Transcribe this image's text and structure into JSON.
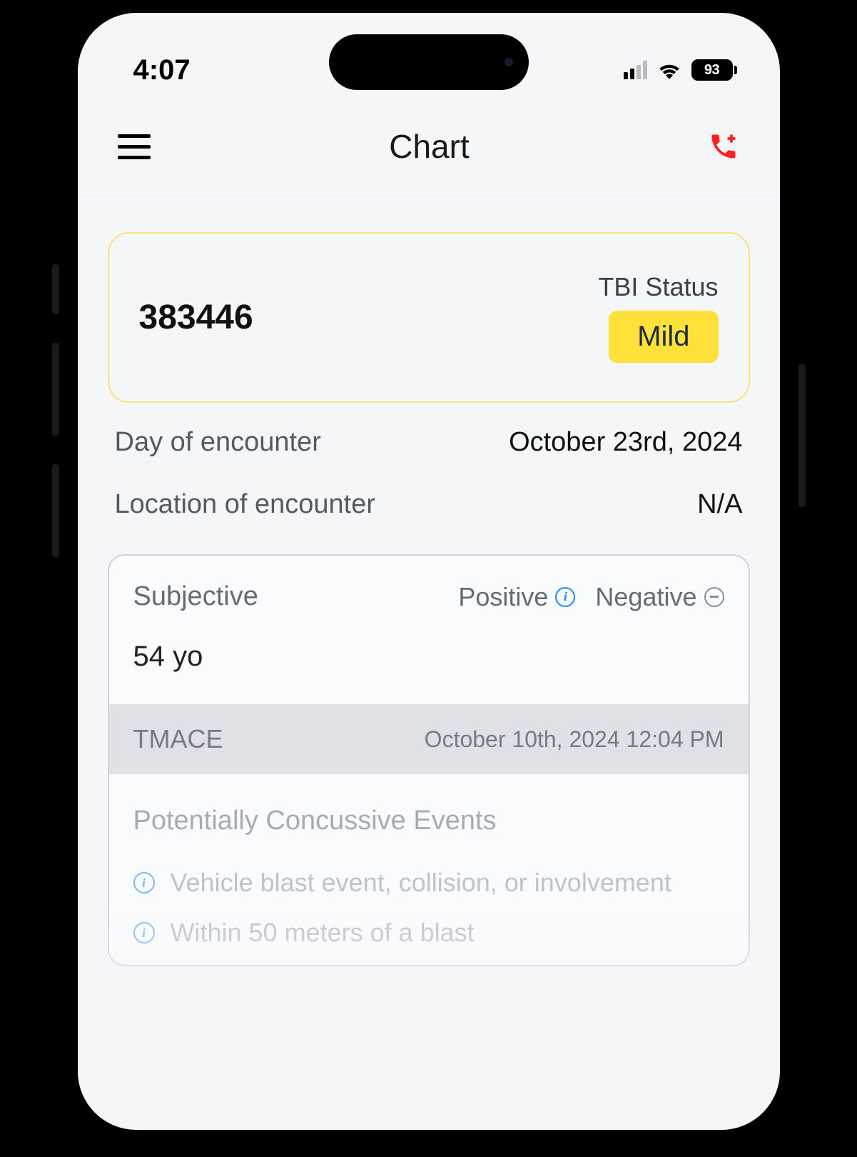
{
  "status_bar": {
    "time": "4:07",
    "battery": "93"
  },
  "nav": {
    "title": "Chart"
  },
  "summary": {
    "id": "383446",
    "status_label": "TBI Status",
    "status_value": "Mild"
  },
  "meta": {
    "day_label": "Day of encounter",
    "day_value": "October 23rd, 2024",
    "location_label": "Location of encounter",
    "location_value": "N/A"
  },
  "subjective": {
    "title": "Subjective",
    "positive_label": "Positive",
    "negative_label": "Negative",
    "age": "54 yo"
  },
  "tmace": {
    "label": "TMACE",
    "timestamp": "October 10th, 2024 12:04 PM"
  },
  "pce": {
    "title": "Potentially Concussive Events",
    "items": [
      "Vehicle blast event, collision, or involvement",
      "Within 50 meters of a blast"
    ]
  }
}
